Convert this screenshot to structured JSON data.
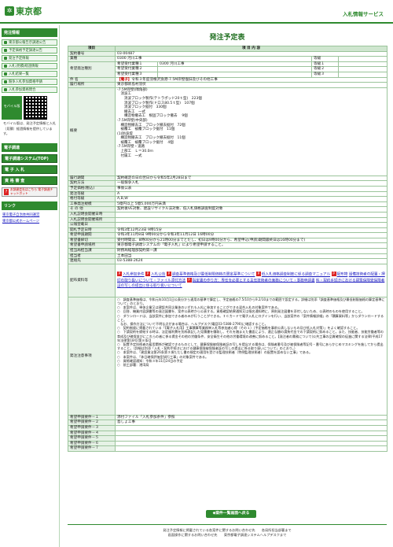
{
  "header": {
    "logo_text": "東京都",
    "service_name": "入札情報サービス"
  },
  "sidebar": {
    "menu_title": "発注情報",
    "items": [
      {
        "label": "東京都公報告示調達公告"
      },
      {
        "label": "予定価格予定調達公告"
      },
      {
        "label": "発注予定情報"
      },
      {
        "label": "入札(見積)経過情報"
      },
      {
        "label": "入札結果一覧"
      },
      {
        "label": "競争入札参加資格申請"
      },
      {
        "label": "入札参加資格問合"
      }
    ],
    "mobile_label": "モバイル版",
    "mobile_badge": "モバイル版",
    "mobile_text": "モバイル版は、発注予定情報と入札（見積）経過情報を提供しています。",
    "system_title": "電子調達",
    "system_buttons": [
      {
        "label": "電子調達システム(TOP)"
      },
      {
        "label": "電 子 入 札"
      },
      {
        "label": "資 格 審 査"
      }
    ],
    "adobe_text": "お調達会社はこちら 電子調達チャットボット",
    "links_title": "リンク",
    "links": [
      {
        "label": "東京電子自治体共同運営"
      },
      {
        "label": "東京都公式ホームページ"
      }
    ]
  },
  "page": {
    "title": "発注予定表",
    "col_item": "項目",
    "col_content": "項 目 内 容",
    "rows": {
      "contract_no_label": "契約番号",
      "contract_no": "03-00487",
      "industry_label": "業種",
      "industry": "0300 河川工事",
      "bid_kind_label": "希望発注種別",
      "bid_kinds": [
        {
          "name": "希望受付業種１",
          "value": "0300 河川工事",
          "tag": "等級"
        },
        {
          "name": "希望受付業種２",
          "value": "",
          "tag": "等級"
        },
        {
          "name": "希望受付業種３",
          "value": "",
          "tag": "等級"
        }
      ],
      "bid_rank_tags": [
        "等級",
        "等級１",
        "等級２",
        "等級３"
      ],
      "subject_label": "件 名",
      "subject_tag": "【電子】",
      "subject": "令和３年度羽根沢漁港-7.5M岸壁復旧及びその他工事",
      "place_label": "履行場所",
      "place": "東京都新島村羽伏",
      "overview_label": "概要",
      "overview": "-7.5M岸壁(隅角部)\n　消波工\n　　消波ブロック製作(テトラポッド20ｔ型)　223個\n　　消波ブロック製作(ドロス80.5ｔ型)　107個\n　　消波ブロック据付　330個\n　　撤去工　一式\n　　構造物撤去工　根固ブロック撤去　 9個\n-7.5M岸壁(中央部)\n　構造物撤去工　ブロック撤去据付　72個\n　被覆工　被覆ブロック据付　11個\n(1)防波堤\n　構造物撤去工　ブロック撤去据付　11個\n　被覆工　被覆ブロック据付　 4個\n-7.5M岸壁・道路\n　上部工　Ｌ＝30.0ｍ\n　付属工　一式",
      "period_label": "履行期間",
      "period": "契約確定の日の翌日から令和5年2月28日まで",
      "method_label": "契約方法",
      "method": "一般競争入札",
      "budget_label": "予定価格(税込)",
      "budget": "事後公表",
      "rank_label": "発注等級",
      "rank": "A",
      "qual_label": "格付等級",
      "qual": "A,B,W",
      "scale_label": "工事発注規模",
      "scale": "5億円以上 5億5,000万円未満",
      "other_label": "そ の 他",
      "other": "契約後VE対象、建設リサイクル法対象、低入札価格調査制度対象",
      "deadline_label": "入札説明会開催日時",
      "deadline": "",
      "venue_label": "入札説明会開催場所",
      "venue": "",
      "public_label": "公報登載日",
      "public": "",
      "open_label": "開札予定日時",
      "open": "令和3年12月23日 9時15分",
      "term_label": "希望申請期間",
      "term": "令和3年11月8日 9時00分から令和3年11月12日 16時00分",
      "accept_label": "希望書締切",
      "accept": "受付時間は、8時00分から21時00分までとだし、初日は9時00分から、希望申込(申請)期間最終日は16時00分まで)",
      "submit_label": "希望書申請場所",
      "submit": "東京都電子調達システムの「電子入札」により希望申請すること。",
      "dept_label": "担当局担当課",
      "dept": "財務局経理部契約第一課",
      "person_label": "担当者",
      "person": "土本田当",
      "tel_label": "連絡先",
      "tel": "03-5388-2624",
      "docs_label": "配布資料等",
      "docs": [
        {
          "label": "入札参加条件"
        },
        {
          "label": "入札公告"
        },
        {
          "label": "調査基準価格及び最低制限価格の算定基準について"
        },
        {
          "label": "低入札価格調査制度に係る調査マニュアル"
        },
        {
          "label": "配布物"
        },
        {
          "label": "設備技術者の配置・押印の取り扱いについて・ファイル添付方法"
        },
        {
          "label": "指定書の作り方：専任を必要とする主任技術者の兼務について・事務申請書"
        },
        {
          "label": "料・契約手続きにおける建築保険受保険者証の写しの提出に係る取り扱いについて"
        }
      ],
      "remarks_label": "発注注意事項",
      "remarks": "○　調査基準価格は、令和元年10月1日公表分から適用の基準で算定し、予定価格の7.5/10から9.2/10までの範囲で設定する。詳細は別添「調査基準価格及び最低制限価格の算定基準について」のとおり。\n○　本案件は、単体企業又は建設共同企業体のいずれも入札に参加することができる混合入札の対象案件である。\n○　回答、機業内容調書等の発注図書を、案件公表時から公表する。資格確認結果通知又は指名通知時に、原則発注図書を添付しないため、公表時のものを使用すること。\n○　ダウンロードは、当該案件に参加できる者のみが行うことができる。ＩＣカードで電子入札にログインを行い、当該案件の「案件情報詳細」の「積算資料等」からダウンロードすること。\n　なお、操作方法について不明な点がある場合は、ヘルプデスク(電話03-5388-2790)に確認すること。\n○　契約制度に掲載されている「【電子入札用】工事積算等業務単入札等参加者心得（その１）（予定価格を事前公表しないもの及び低入札対策）」をよく確認すること。\n○　下請契約を締結する時は、法定福利費を別枠表記した見積書を徴取し、それを踏まえた書面により、適正な額の請負代金での下請契約に努めること。また、技能者、技能労働者等の育成及び確保並びにこれらの者に係る賃金その他の労働条件、安全衛生その他の労働環境の改善に努めること。【発注者の責務について(公共工事の品質確保の促進に関する法律(平成17年法律第18号)第８条)】\n○　配置予定技術者の雇用関係が確認できるものとして、健康保険被保険者証の写しを提出する場合は、保険者番号及び被保険者等記号・番号にあらかじめマスキングを施してから提出すること。（詳細は別添「入札・契約手続きにおける健康保険被保険者証の写しの提出に係る取り扱いについて」のとおり。）\n○　本案件は、「建設業法第26条第３項ただし書の規定の適用を受ける監理技術者（特例監理技術者）の配置を認めない工事」である。\n○　本案件は、「休日確保評価型試行工事」の対象案件である。\n○　資格確認通知：令和３年11月24日の予定\n○　前工部署：港湾局",
      "bid1_label": "希望申請要件－１",
      "bid1": "添付ファイル「入札参加条件」参照",
      "bid2_label": "希望申請要件－２",
      "bid2": "島しょ工事",
      "bid3_label": "希望申請要件－３",
      "bid4_label": "希望申請要件－４",
      "bid5_label": "希望申請要件－５",
      "bid6_label": "希望申請要件－６",
      "bid7_label": "希望申請要件－７"
    },
    "back_button": "◆案件一覧画面へ戻る",
    "footer_line1": "発注予定情報に掲載されている各案件に関するお問い合わせ先　　各局所担当部署まで",
    "footer_line2": "画面操作に関するお問い合わせ先　　東京都電子調達システムヘルプデスクまで"
  }
}
